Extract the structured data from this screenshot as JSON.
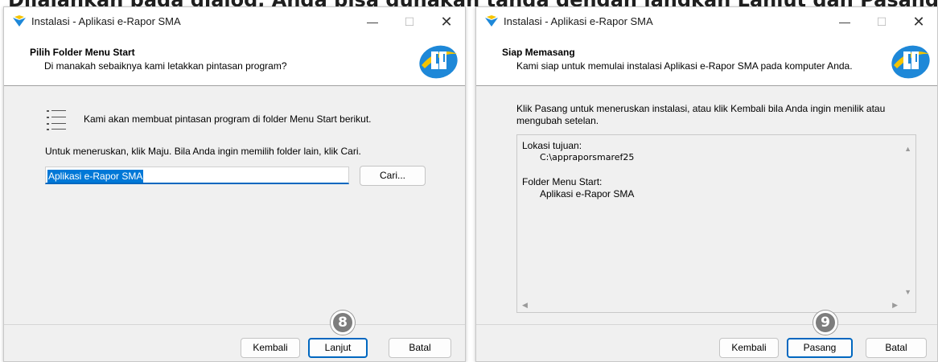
{
  "top_strip_text": "Dijalankan pada dialog, Anda bisa gunakan tanda dengan langkah Lanjut dan Pasang yang sama",
  "left_window": {
    "title": "Instalasi - Aplikasi e-Rapor SMA",
    "header_title": "Pilih Folder Menu Start",
    "header_subtitle": "Di manakah sebaiknya kami letakkan pintasan program?",
    "info_text": "Kami akan membuat pintasan program di folder Menu Start berikut.",
    "instruction_text": "Untuk meneruskan, klik Maju. Bila Anda ingin memilih folder lain, klik Cari.",
    "folder_value": "Aplikasi e-Rapor SMA",
    "browse_label": "Cari...",
    "back_label": "Kembali",
    "next_label": "Lanjut",
    "cancel_label": "Batal",
    "step_number": "8"
  },
  "right_window": {
    "title": "Instalasi - Aplikasi e-Rapor SMA",
    "header_title": "Siap Memasang",
    "header_subtitle": "Kami siap untuk memulai instalasi Aplikasi e-Rapor SMA pada komputer Anda.",
    "instruction_line1": "Klik Pasang untuk meneruskan instalasi, atau klik Kembali bila Anda ingin menilik atau",
    "instruction_line2": "mengubah setelan.",
    "memo": {
      "dest_label": "Lokasi tujuan:",
      "dest_value": "C:\\appraporsmaref25",
      "menu_label": "Folder Menu Start:",
      "menu_value": "Aplikasi e-Rapor SMA"
    },
    "back_label": "Kembali",
    "install_label": "Pasang",
    "cancel_label": "Batal",
    "step_number": "9"
  },
  "colors": {
    "accent": "#0067c0",
    "selection": "#0078d7",
    "logo_blue": "#1e88d8",
    "logo_yellow": "#f5c400",
    "badge_gray": "#7d7d7d"
  },
  "icons": {
    "app": "app-logo-icon",
    "minimize": "minimize-icon",
    "maximize": "maximize-icon",
    "close": "close-icon",
    "list": "list-icon",
    "brand": "brand-logo"
  }
}
